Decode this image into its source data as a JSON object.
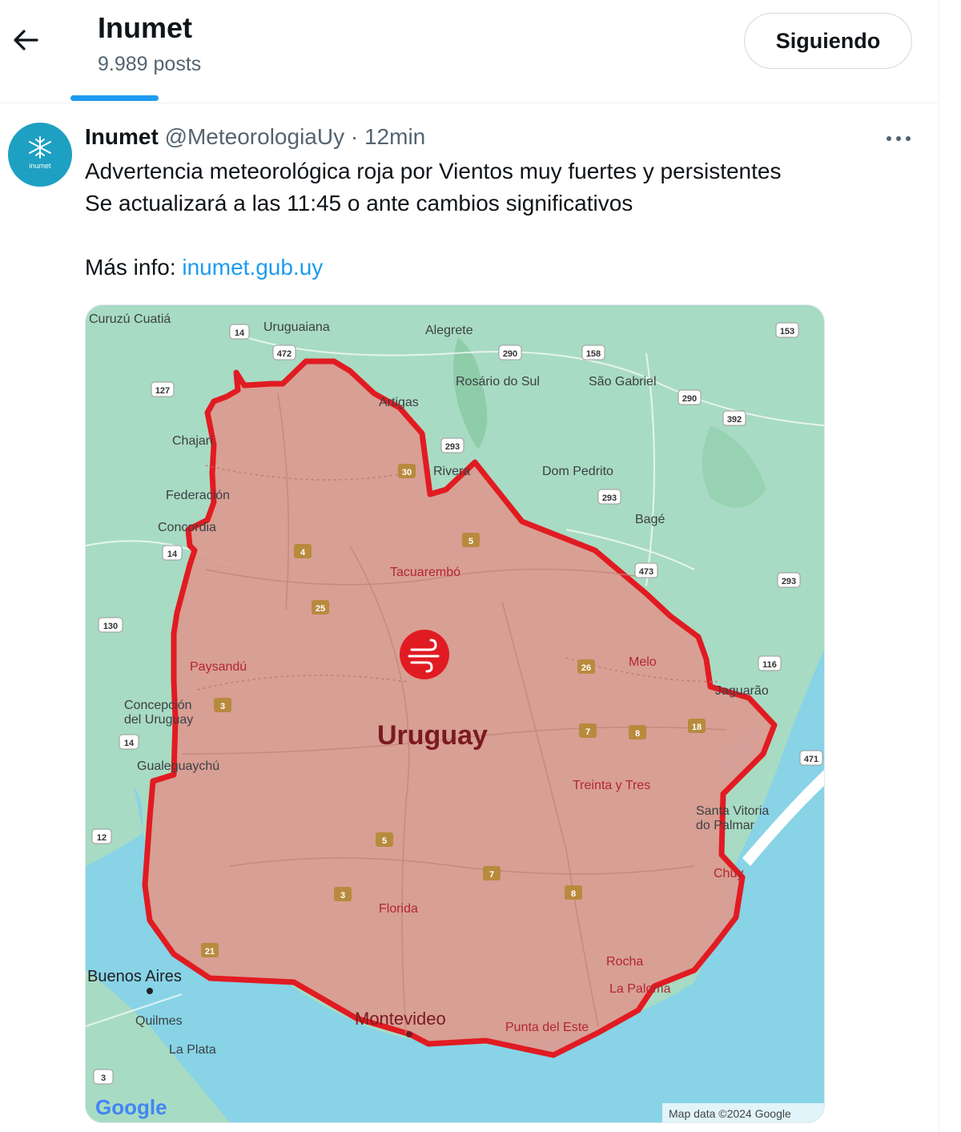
{
  "header": {
    "back_icon": "arrow-left-icon",
    "title": "Inumet",
    "posts_count": "9.989 posts",
    "follow_button": "Siguiendo"
  },
  "tweet": {
    "avatar_label": "inumet",
    "author_name": "Inumet",
    "handle": "@MeteorologiaUy",
    "separator": "·",
    "time": "12min",
    "more_icon": "more-dots-icon",
    "line1": "Advertencia meteorológica roja por Vientos muy fuertes y persistentes",
    "line2": "Se actualizará a las 11:45 o ante cambios significativos",
    "info_prefix": "Más info: ",
    "info_link": "inumet.gub.uy"
  },
  "map": {
    "country": "Uruguay",
    "alert_color": "#e11b22",
    "alert_fill": "#dc9a90",
    "alert_icon": "wind-icon",
    "places": [
      "Curuzú Cuatiá",
      "Uruguaiana",
      "Alegrete",
      "Rosário do Sul",
      "São Gabriel",
      "Artigas",
      "Chajarí",
      "Rivera",
      "Dom Pedrito",
      "Federación",
      "Concordia",
      "Bagé",
      "Tacuarembó",
      "Paysandú",
      "Melo",
      "Concepción",
      "del Uruguay",
      "Jaguarão",
      "Gualeguaychú",
      "Treinta y Tres",
      "Santa Vitoria",
      "do Palmar",
      "Chuy",
      "Florida",
      "Rocha",
      "Buenos Aires",
      "La Paloma",
      "Montevideo",
      "Punta del Este",
      "Quilmes",
      "La Plata"
    ],
    "routes": [
      "14",
      "472",
      "290",
      "158",
      "153",
      "127",
      "290",
      "392",
      "293",
      "293",
      "473",
      "293",
      "130",
      "116",
      "14",
      "471",
      "12",
      "3",
      "30",
      "5",
      "4",
      "25",
      "26",
      "7",
      "8",
      "18",
      "3",
      "5",
      "7",
      "8",
      "3",
      "21"
    ],
    "google_logo": "Google",
    "attribution": "Map data ©2024 Google"
  }
}
